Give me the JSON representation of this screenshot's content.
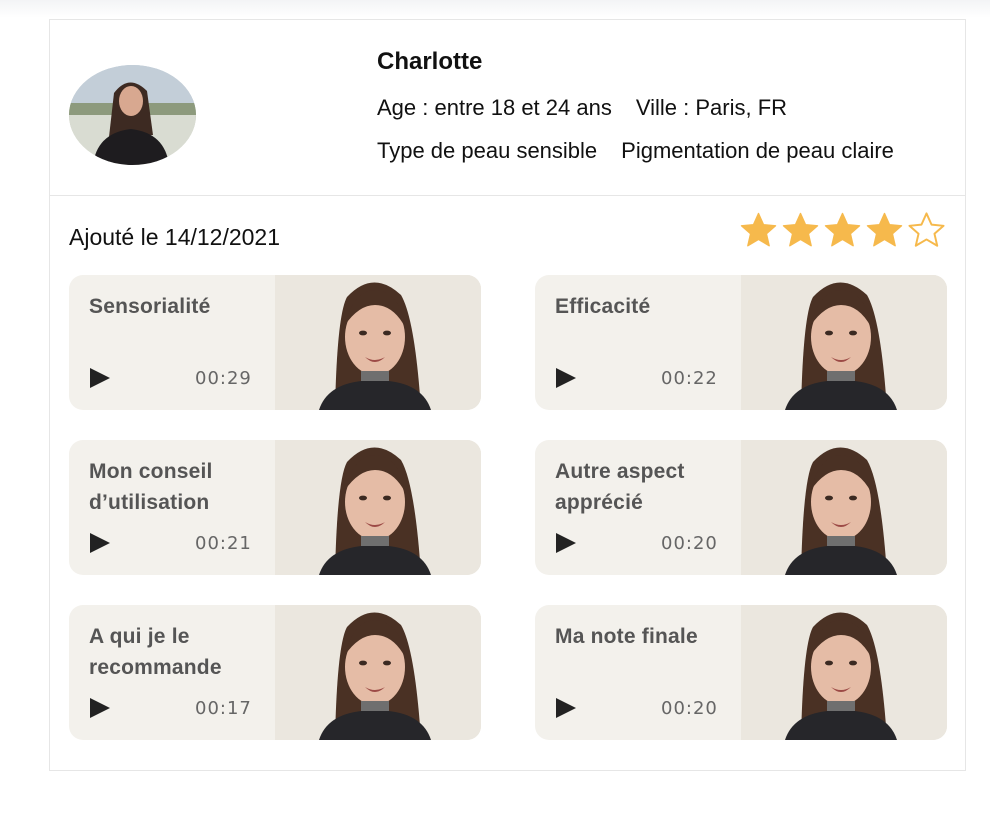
{
  "profile": {
    "name": "Charlotte",
    "age": "Age : entre 18 et 24 ans",
    "city": "Ville : Paris, FR",
    "skin_type": "Type de peau sensible",
    "pigmentation": "Pigmentation de peau claire"
  },
  "review": {
    "added_date": "Ajouté le 14/12/2021",
    "rating": 4,
    "rating_max": 5,
    "star_color": "#f6b94c"
  },
  "videos": [
    {
      "title": "Sensorialité",
      "duration": "00:29"
    },
    {
      "title": "Efficacité",
      "duration": "00:22"
    },
    {
      "title": "Mon conseil d’utilisation",
      "duration": "00:21"
    },
    {
      "title": "Autre aspect apprécié",
      "duration": "00:20"
    },
    {
      "title": "A qui je le recommande",
      "duration": "00:17"
    },
    {
      "title": "Ma note finale",
      "duration": "00:20"
    }
  ]
}
